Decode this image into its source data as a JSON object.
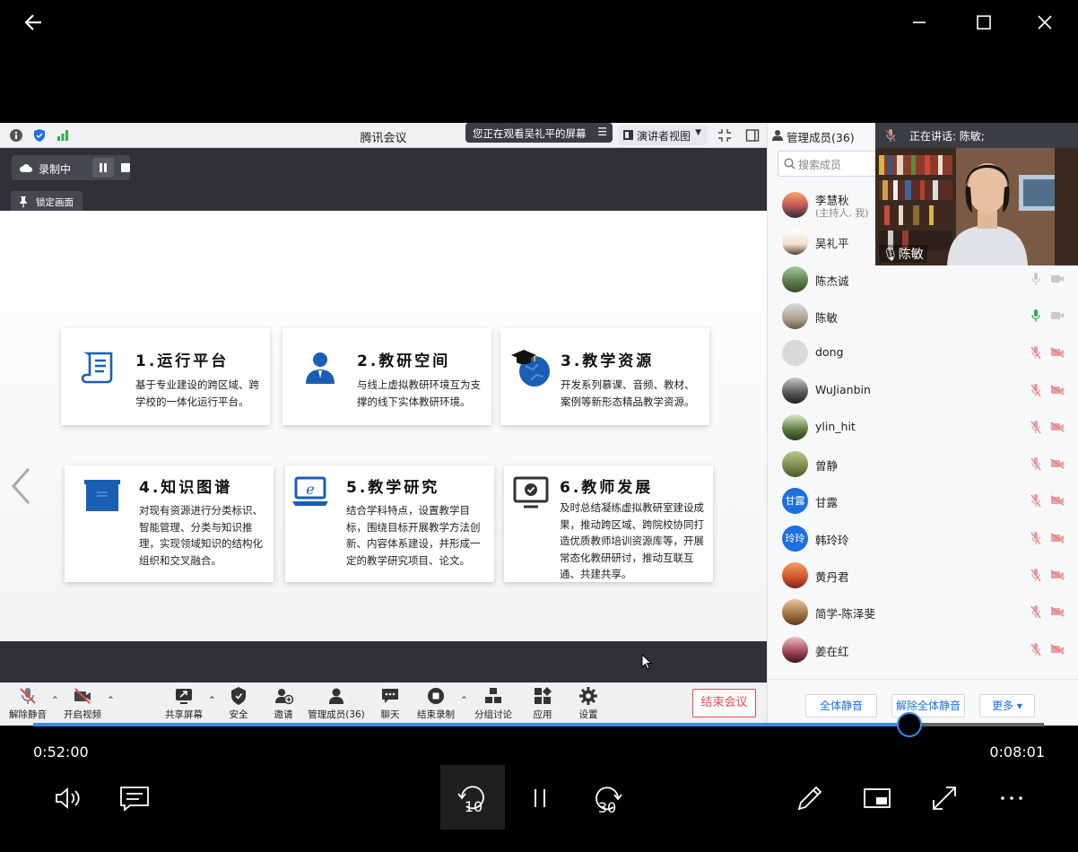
{
  "meeting": {
    "title": "腾讯会议",
    "viewing_banner": "您正在观看吴礼平的屏幕",
    "presenter_view": "演讲者视图",
    "recording_label": "录制中",
    "lock_view_label": "锁定画面"
  },
  "slide": {
    "cards": [
      {
        "title": "1.运行平台",
        "desc": "基于专业建设的跨区域、跨学校的一体化运行平台。",
        "icon": "scroll-icon"
      },
      {
        "title": "2.教研空间",
        "desc": "与线上虚拟教研环境互为支撑的线下实体教研环境。",
        "icon": "person-icon"
      },
      {
        "title": "3.教学资源",
        "desc": "开发系列慕课、音频、教材、案例等新形态精品教学资源。",
        "icon": "graduation-globe-icon"
      },
      {
        "title": "4.知识图谱",
        "desc": "对现有资源进行分类标识、智能管理、分类与知识推理，实现领域知识的结构化组织和交叉融合。",
        "icon": "folder-icon"
      },
      {
        "title": "5.教学研究",
        "desc": "结合学科特点，设置教学目标，围绕目标开展教学方法创新、内容体系建设，并形成一定的教学研究项目、论文。",
        "icon": "laptop-ie-icon"
      },
      {
        "title": "6.教师发展",
        "desc": "及时总结凝练虚拟教研室建设成果，推动跨区域、跨院校协同打造优质教师培训资源库等，开展常态化教研研讨，推动互联互通、共建共享。",
        "icon": "monitor-check-icon"
      }
    ]
  },
  "toolbar": {
    "unmute": "解除静音",
    "video": "开启视频",
    "share": "共享屏幕",
    "security": "安全",
    "invite": "邀请",
    "members": "管理成员(36)",
    "chat": "聊天",
    "end_record": "结束录制",
    "breakout": "分组讨论",
    "apps": "应用",
    "settings": "设置",
    "end_meeting": "结束会议"
  },
  "panel": {
    "header": "管理成员(36)",
    "search_placeholder": "搜索成员",
    "speaking": "正在讲话: 陈敏;",
    "video_name": "陈敏",
    "participants": [
      {
        "name": "李慧秋",
        "sub": "(主持人, 我)",
        "mic": "none",
        "cam": "none",
        "avatar": "sunset"
      },
      {
        "name": "吴礼平",
        "sub": "",
        "mic": "none",
        "cam": "none",
        "avatar": "cartoon"
      },
      {
        "name": "陈杰诚",
        "sub": "",
        "mic": "off-gray",
        "cam": "off-gray",
        "avatar": "landscape"
      },
      {
        "name": "陈敏",
        "sub": "",
        "mic": "active",
        "cam": "off-gray",
        "avatar": "room"
      },
      {
        "name": "dong",
        "sub": "",
        "mic": "muted",
        "cam": "muted",
        "avatar": "default"
      },
      {
        "name": "WuJianbin",
        "sub": "",
        "mic": "muted",
        "cam": "muted",
        "avatar": "photo"
      },
      {
        "name": "ylin_hit",
        "sub": "",
        "mic": "muted",
        "cam": "muted",
        "avatar": "green"
      },
      {
        "name": "曾静",
        "sub": "",
        "mic": "muted",
        "cam": "muted",
        "avatar": "field"
      },
      {
        "name": "甘露",
        "sub": "",
        "mic": "muted",
        "cam": "muted",
        "avatar": "text",
        "avatar_text": "甘露"
      },
      {
        "name": "韩玲玲",
        "sub": "",
        "mic": "muted",
        "cam": "muted",
        "avatar": "text",
        "avatar_text": "玲玲"
      },
      {
        "name": "黄丹君",
        "sub": "",
        "mic": "muted",
        "cam": "muted",
        "avatar": "orange"
      },
      {
        "name": "简学-陈泽斐",
        "sub": "",
        "mic": "muted",
        "cam": "muted",
        "avatar": "brown"
      },
      {
        "name": "姜在红",
        "sub": "",
        "mic": "muted",
        "cam": "muted",
        "avatar": "pink"
      }
    ],
    "mute_all": "全体静音",
    "unmute_all": "解除全体静音",
    "more": "更多 ▾"
  },
  "player": {
    "elapsed": "0:52:00",
    "remaining": "0:08:01",
    "progress": 0.867,
    "skip_back": "10",
    "skip_forward": "30"
  },
  "colors": {
    "accent": "#3a8be8",
    "danger": "#e34d4d",
    "brand_blue": "#1f6fe0",
    "icon_blue": "#1a5fb4"
  }
}
